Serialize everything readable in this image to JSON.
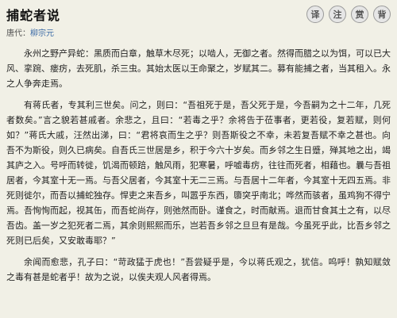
{
  "header": {
    "title": "捕蛇者说",
    "author_prefix": "唐代：",
    "author_name": "柳宗元",
    "tools": [
      "译",
      "注",
      "赏",
      "背"
    ]
  },
  "paragraphs": [
    "永州之野产异蛇：黑质而白章，触草木尽死；以啮人，无御之者。然得而腊之以为饵，可以已大风、挛踠、瘘疠，去死肌，杀三虫。其始太医以王命聚之，岁赋其二。募有能捕之者，当其租入。永之人争奔走焉。",
    "有蒋氏者，专其利三世矣。问之，则曰：“吾祖死于是，吾父死于是，今吾嗣为之十二年，几死者数矣。”言之貌若甚戚者。余悲之，且曰：“若毒之乎？余将告于莅事者，更若役，复若赋，则何如？”蒋氏大戚，汪然出涕，曰：“君将哀而生之乎？则吾斯役之不幸，未若复吾赋不幸之甚也。向吾不为斯役，则久已病矣。自吾氏三世居是乡，积于今六十岁矣。而乡邻之生日蹙，殚其地之出，竭其庐之入。号呼而转徙，饥渴而顿踣，触风雨，犯寒暑，呼嘘毒疠，往往而死者，相藉也。曩与吾祖居者，今其室十无一焉。与吾父居者，今其室十无二三焉。与吾居十二年者，今其室十无四五焉。非死则徙尔，而吾以捕蛇独存。悍吏之来吾乡，叫嚣乎东西，隳突乎南北；哗然而骇者，虽鸡狗不得宁焉。吾恂恂而起，视其缶，而吾蛇尚存，则弛然而卧。谨食之，时而献焉。退而甘食其土之有，以尽吾齿。盖一岁之犯死者二焉，其余则熙熙而乐，岂若吾乡邻之旦旦有是哉。今虽死乎此，比吾乡邻之死则已后矣，又安敢毒耶？”",
    "余闻而愈悲，孔子曰：“苛政猛于虎也！”吾尝疑乎是，今以蒋氏观之，犹信。呜呼！孰知赋敛之毒有甚是蛇者乎！故为之说，以俟夫观人风者得焉。"
  ]
}
